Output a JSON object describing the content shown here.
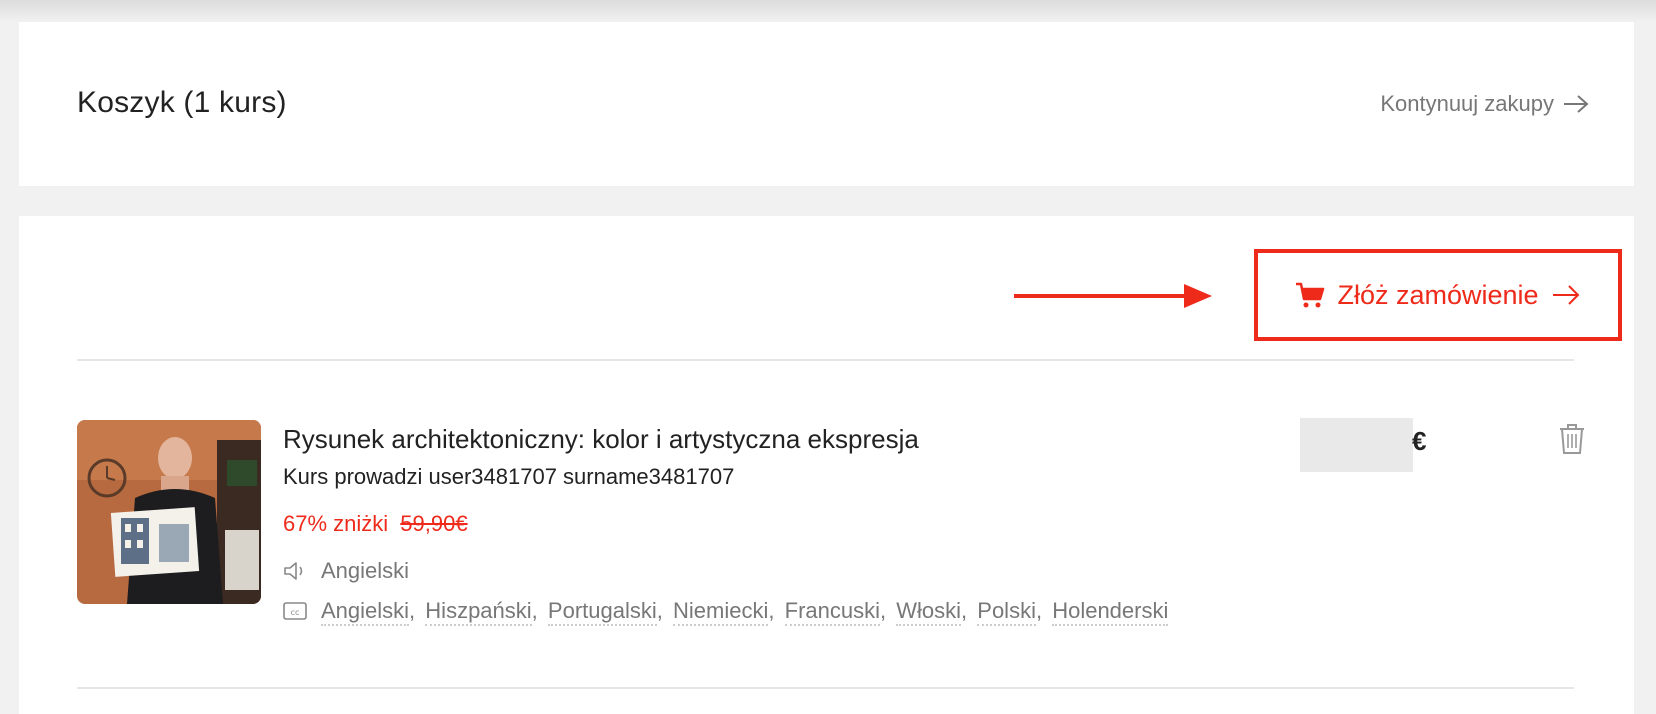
{
  "header": {
    "title": "Koszyk  (1 kurs)",
    "continue_label": "Kontynuuj zakupy"
  },
  "order": {
    "button_label": "Złóż zamówienie"
  },
  "item": {
    "title": "Rysunek architektoniczny: kolor i artystyczna ekspresja",
    "author": "Kurs prowadzi user3481707 surname3481707",
    "discount": "67% zniżki",
    "old_price": "59,90€",
    "currency": "€",
    "audio_language": "Angielski",
    "subtitles": [
      "Angielski",
      "Hiszpański",
      "Portugalski",
      "Niemiecki",
      "Francuski",
      "Włoski",
      "Polski",
      "Holenderski"
    ]
  },
  "colors": {
    "accent": "#ee2a1b",
    "muted": "#777777",
    "background": "#f1f1f1"
  },
  "icons": {
    "cart": "shopping-cart-icon",
    "arrow": "arrow-right-icon",
    "audio": "speaker-icon",
    "subtitles": "closed-captions-icon",
    "delete": "trash-icon"
  }
}
